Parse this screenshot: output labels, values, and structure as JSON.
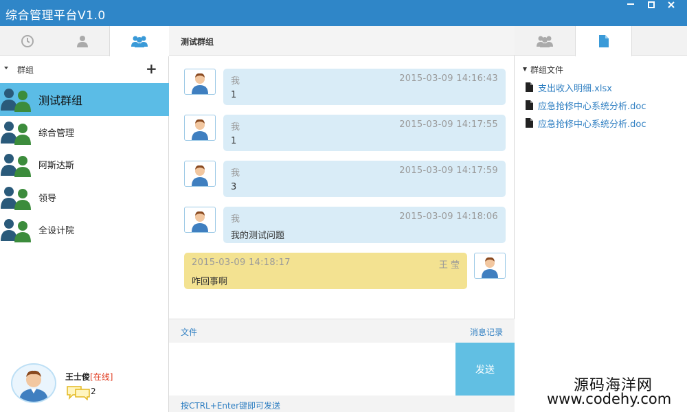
{
  "window": {
    "title": "综合管理平台V1.0"
  },
  "left": {
    "group_header": "群组",
    "groups": [
      {
        "name": "测试群组"
      },
      {
        "name": "综合管理"
      },
      {
        "name": "阿斯达斯"
      },
      {
        "name": "领导"
      },
      {
        "name": "全设计院"
      }
    ],
    "user": {
      "name": "王士俊",
      "status": "[在线]",
      "msg_count": "2"
    }
  },
  "chat": {
    "title": "测试群组",
    "messages": [
      {
        "sender": "我",
        "time": "2015-03-09 14:16:43",
        "text": "1"
      },
      {
        "sender": "我",
        "time": "2015-03-09 14:17:55",
        "text": "1"
      },
      {
        "sender": "我",
        "time": "2015-03-09 14:17:59",
        "text": "3"
      },
      {
        "sender": "我",
        "time": "2015-03-09 14:18:06",
        "text": "我的测试问题"
      },
      {
        "sender": "王 莹",
        "time": "2015-03-09 14:18:17",
        "text": "咋回事啊"
      }
    ],
    "file_label": "文件",
    "history_label": "消息记录",
    "send_label": "发送",
    "hint": "按CTRL+Enter键即可发送"
  },
  "right": {
    "files_header": "群组文件",
    "files": [
      {
        "name": "支出收入明细.xlsx"
      },
      {
        "name": "应急抢修中心系统分析.doc"
      },
      {
        "name": "应急抢修中心系统分析.doc"
      }
    ]
  },
  "watermark": {
    "line1": "源码海洋网",
    "line2": "www.codehy.com"
  },
  "colors": {
    "titlebar": "#2f86c8",
    "active_group": "#5bbce6",
    "bubble_other": "#d9ecf7",
    "bubble_mine": "#f3e291",
    "send_button": "#61bfe3",
    "link": "#2f7fc2"
  }
}
